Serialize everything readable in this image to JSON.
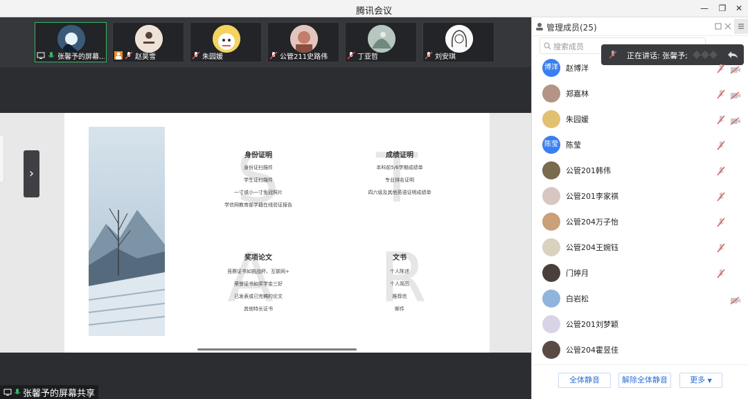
{
  "window": {
    "title": "腾讯会议"
  },
  "thumbnails": [
    {
      "name": "张馨予的屏幕...",
      "active": true
    },
    {
      "name": "赵昊雪",
      "active": false
    },
    {
      "name": "朱园媛",
      "active": false
    },
    {
      "name": "公管211史路伟",
      "active": false
    },
    {
      "name": "丁亚哲",
      "active": false
    },
    {
      "name": "刘安琪",
      "active": false
    }
  ],
  "slide": {
    "letters": [
      "S",
      "T",
      "A",
      "R"
    ],
    "sections": [
      {
        "heading": "身份证明",
        "lines": [
          "身份证扫描件",
          "学生证扫描件",
          "一寸或小一寸免冠照片",
          "学信网教育部学籍在线验证报告"
        ]
      },
      {
        "heading": "成绩证明",
        "lines": [
          "本科前5/6学期成绩单",
          "专业排名证明",
          "四六级及其他英语证明成绩单"
        ]
      },
      {
        "heading": "奖项论文",
        "lines": [
          "竞赛证书如挑战杯、互联网+",
          "荣誉证书如奖学金三好",
          "已发表或已完稿的论文",
          "其他特长证书"
        ]
      },
      {
        "heading": "文书",
        "lines": [
          "个人陈述",
          "个人简历",
          "推荐信",
          "邮件"
        ]
      }
    ]
  },
  "share_label": "张馨予的屏幕共享",
  "panel": {
    "title": "管理成员(25)",
    "search_placeholder": "搜索成员",
    "speaking": "正在讲话: 张馨予;",
    "members": [
      {
        "name": "赵博洋",
        "avatar_text": "博洋",
        "avatar_color": "#3a7ff0",
        "mic_muted": true,
        "cam": true
      },
      {
        "name": "郑嘉林",
        "avatar_text": "",
        "avatar_color": "#b49486",
        "mic_muted": true,
        "cam": true
      },
      {
        "name": "朱园媛",
        "avatar_text": "",
        "avatar_color": "#e2c071",
        "mic_muted": true,
        "cam": true
      },
      {
        "name": "陈莹",
        "avatar_text": "陈莹",
        "avatar_color": "#3a7ff0",
        "mic_muted": true,
        "cam": false
      },
      {
        "name": "公管201韩伟",
        "avatar_text": "",
        "avatar_color": "#7a6a4e",
        "mic_muted": true,
        "cam": false
      },
      {
        "name": "公管201李家祺",
        "avatar_text": "",
        "avatar_color": "#d7c7c0",
        "mic_muted": true,
        "cam": false
      },
      {
        "name": "公管204万子怡",
        "avatar_text": "",
        "avatar_color": "#c9a07a",
        "mic_muted": true,
        "cam": false
      },
      {
        "name": "公管204王婉钰",
        "avatar_text": "",
        "avatar_color": "#d9d2bf",
        "mic_muted": true,
        "cam": false
      },
      {
        "name": "门婷月",
        "avatar_text": "",
        "avatar_color": "#4a3f3a",
        "mic_muted": true,
        "cam": false
      },
      {
        "name": "白岩松",
        "avatar_text": "",
        "avatar_color": "#8fb5dc",
        "mic_muted": false,
        "cam": true
      },
      {
        "name": "公管201刘梦颖",
        "avatar_text": "",
        "avatar_color": "#d9d3e8",
        "mic_muted": false,
        "cam": false
      },
      {
        "name": "公管204霍昱佳",
        "avatar_text": "",
        "avatar_color": "#5a4a44",
        "mic_muted": false,
        "cam": false
      }
    ],
    "buttons": {
      "mute_all": "全体静音",
      "unmute_all": "解除全体静音",
      "more": "更多"
    }
  },
  "colors": {
    "accent": "#2f6fd6",
    "active_border": "#39b56a",
    "muted_red": "#e05353"
  }
}
